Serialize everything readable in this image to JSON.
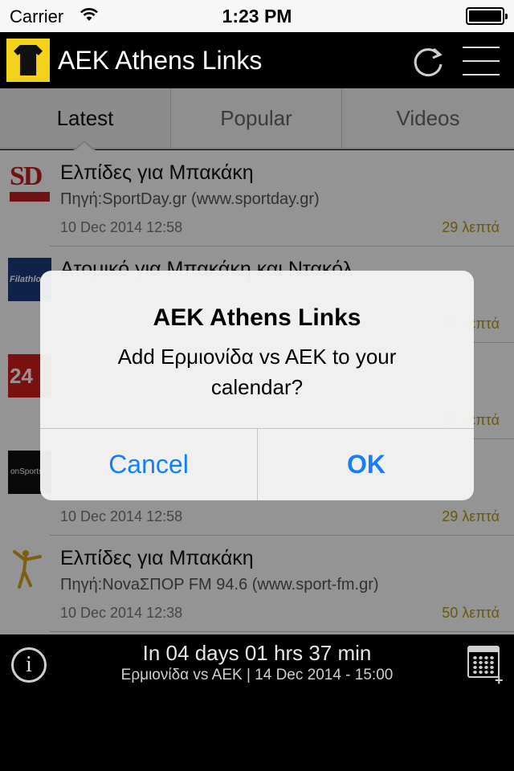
{
  "status_bar": {
    "carrier": "Carrier",
    "time": "1:23 PM"
  },
  "header": {
    "title": "AEK Athens Links"
  },
  "tabs": [
    {
      "label": "Latest",
      "active": true
    },
    {
      "label": "Popular",
      "active": false
    },
    {
      "label": "Videos",
      "active": false
    }
  ],
  "articles": [
    {
      "headline": "Ελπίδες για Μπακάκη",
      "source": "Πηγή:SportDay.gr (www.sportday.gr)",
      "date": "10 Dec 2014 12:58",
      "ago": "29 λεπτά",
      "thumb_text": "SD"
    },
    {
      "headline": "Ατομικό για Μπακάκη και Ντακόλ",
      "source": "",
      "date": "",
      "ago": "29 λεπτά",
      "thumb_text": "Filathlos"
    },
    {
      "headline": "",
      "source": "",
      "date": "",
      "ago": "29 λεπτά",
      "thumb_text": "24"
    },
    {
      "headline": "",
      "source": "",
      "date": "10 Dec 2014 12:58",
      "ago": "29 λεπτά",
      "thumb_text": "onSports"
    },
    {
      "headline": "Ελπίδες για Μπακάκη",
      "source": "Πηγή:NovaΣΠΟΡ FM 94.6 (www.sport-fm.gr)",
      "date": "10 Dec 2014 12:38",
      "ago": "50 λεπτά",
      "thumb_text": ""
    }
  ],
  "alert": {
    "title": "AEK Athens Links",
    "message": "Add Ερμιονίδα vs AEK to your calendar?",
    "cancel_label": "Cancel",
    "ok_label": "OK"
  },
  "footer": {
    "countdown": "In 04 days 01 hrs 37 min",
    "fixture": "Ερμιονίδα vs AEK | 14 Dec 2014 - 15:00",
    "info_glyph": "i",
    "calendar_plus": "+"
  },
  "colors": {
    "accent_yellow": "#f3d21c",
    "ago_text": "#b59613",
    "ios_blue": "#157efb"
  },
  "icons": [
    "wifi-icon",
    "battery-icon",
    "team-shirt-icon",
    "refresh-icon",
    "menu-icon",
    "info-icon",
    "calendar-add-icon"
  ]
}
